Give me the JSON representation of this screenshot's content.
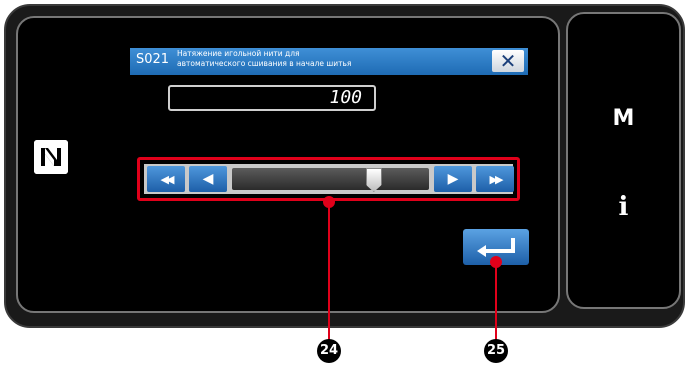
{
  "side_panel": {
    "mode_label": "M",
    "info_label": "i"
  },
  "dialog": {
    "code": "S021",
    "title_line1": "Натяжение игольной нити для",
    "title_line2": "автоматического сшивания в начале шитья",
    "close_label": "✕",
    "value": "100"
  },
  "slider": {
    "fast_back_label": "◀◀",
    "back_label": "◀",
    "forward_label": "▶",
    "fast_forward_label": "▶▶",
    "level": 0.72
  },
  "callouts": {
    "slider_marker": "24",
    "enter_marker": "25"
  },
  "colors": {
    "accent_blue": "#1e6bb4",
    "callout_red": "#e0001a"
  },
  "icons": {
    "nfc": "nfc-icon",
    "enter": "enter-return-icon",
    "close": "close-icon"
  }
}
